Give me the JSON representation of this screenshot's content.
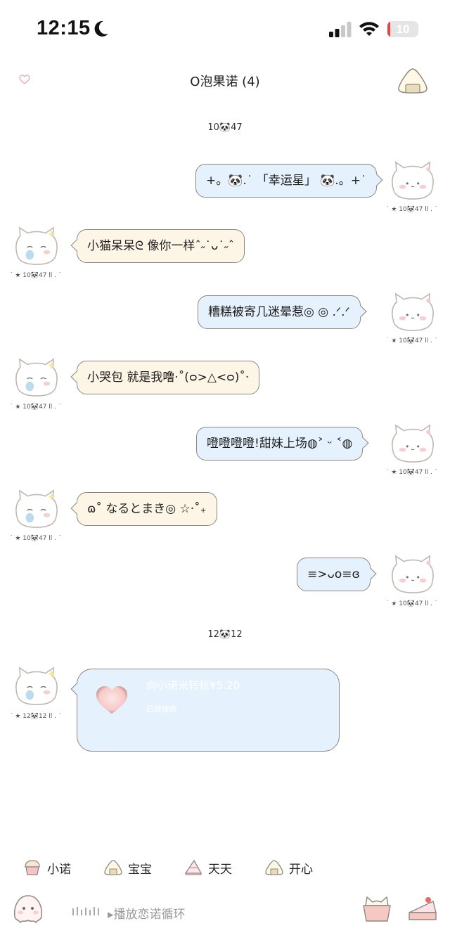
{
  "status_bar": {
    "time": "12:15",
    "battery": "10",
    "battery_level": 0.1
  },
  "header": {
    "title": "O泡果诺 (4)"
  },
  "timestamps": [
    "10🐼47",
    "12🐼12"
  ],
  "messages": [
    {
      "side": "sent",
      "text": "+。🐼.˙ 「幸运星」 🐼.。+˙",
      "meta": "˙ ★ 10🐼47 ll . ˙"
    },
    {
      "side": "recv",
      "text": "小猫呆呆ᘓ 像你一样ˆ˶˙ᴗ˙˶ˆ",
      "meta": "˙ ★ 10🐼47 ll . ˙"
    },
    {
      "side": "sent",
      "text": "糟糕被寄几迷晕惹◎ ◎ .ᐟ.ᐟ",
      "meta": "˙ ★ 10🐼47 ll . ˙"
    },
    {
      "side": "recv",
      "text": "小哭包 就是我噜·˚(ᴑ>△<ᴑ)˚·",
      "meta": "˙ ★ 10🐼47 ll . ˙"
    },
    {
      "side": "sent",
      "text": "噔噔噔噔!甜妹上场◍˃ ᵕ ˂◍",
      "meta": "˙ ★ 10🐼47 ll . ˙"
    },
    {
      "side": "recv",
      "text": "ɷ˚ なるとまき◎ ☆·˚₊",
      "meta": "˙ ★ 10🐼47 ll . ˙"
    },
    {
      "side": "sent",
      "text": "≡>ᴗo≡ɞ",
      "meta": "˙ ★ 10🐼47 ll . ˙"
    }
  ],
  "transfer": {
    "title": "向小诺米转账¥5.20",
    "status": "已被接收",
    "meta": "˙ ★ 12🐼12 ll . ˙"
  },
  "quick_bar": [
    {
      "label": "小诺",
      "icon": "cupcake-icon"
    },
    {
      "label": "宝宝",
      "icon": "onigiri-icon"
    },
    {
      "label": "天天",
      "icon": "cake-slice-icon"
    },
    {
      "label": "开心",
      "icon": "onigiri-icon"
    }
  ],
  "input_bar": {
    "voice_text": "▸播放恋诺循环"
  },
  "colors": {
    "sent_bubble": "#e5f1fc",
    "recv_bubble": "#fdf6e6",
    "border": "#8d8782",
    "battery": "#e0473e"
  }
}
